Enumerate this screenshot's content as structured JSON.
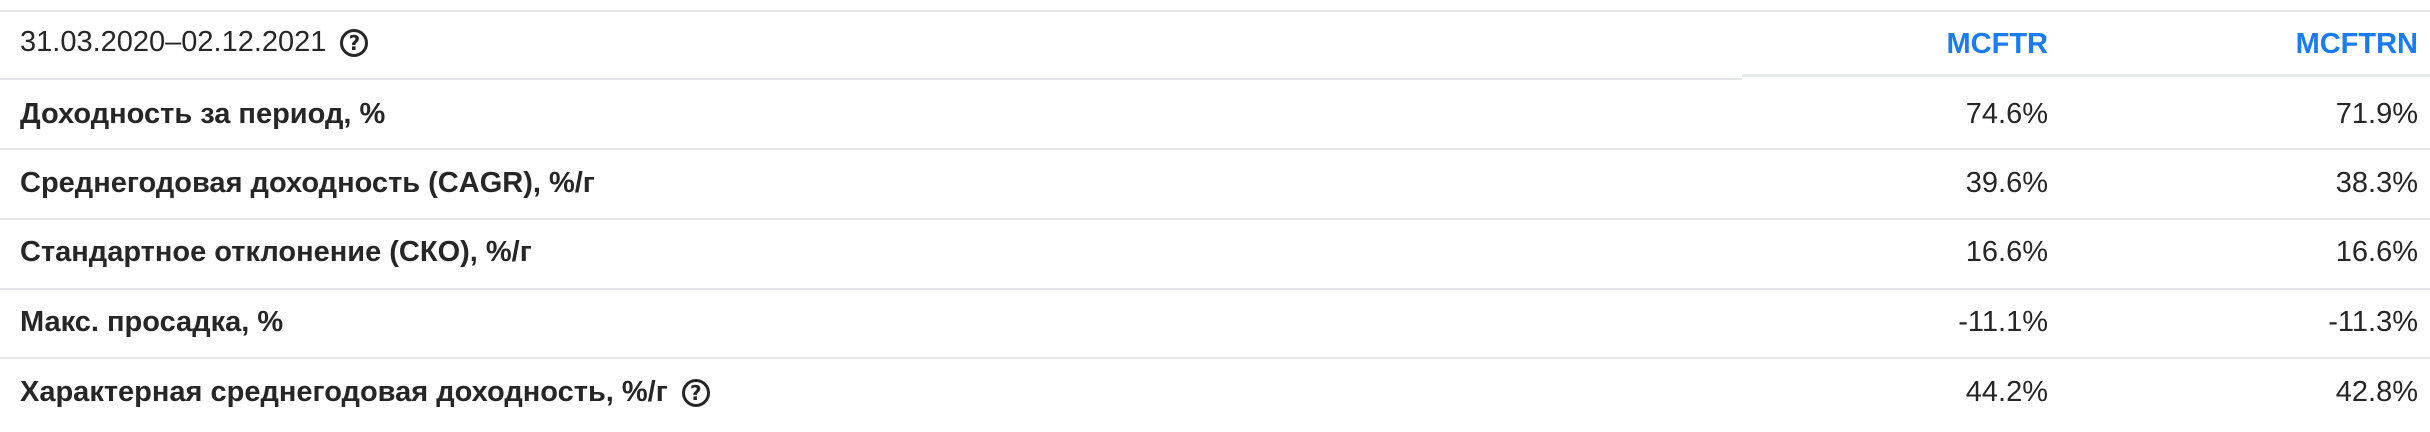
{
  "header": {
    "period": "31.03.2020–02.12.2021",
    "period_help": "?",
    "columns": [
      "MCFTR",
      "MCFTRN"
    ]
  },
  "rows": [
    {
      "label": "Доходность за период, %",
      "values": [
        "74.6%",
        "71.9%"
      ]
    },
    {
      "label": "Среднегодовая доходность (CAGR), %/г",
      "values": [
        "39.6%",
        "38.3%"
      ]
    },
    {
      "label": "Стандартное отклонение (СКО), %/г",
      "values": [
        "16.6%",
        "16.6%"
      ]
    },
    {
      "label": "Макс. просадка, %",
      "values": [
        "-11.1%",
        "-11.3%"
      ]
    },
    {
      "label": "Характерная среднегодовая доходность, %/г",
      "values": [
        "44.2%",
        "42.8%"
      ],
      "help": "?"
    }
  ],
  "colors": {
    "accent": "#1a7cf4",
    "divider": "#e3e5e8",
    "text": "#262626"
  }
}
